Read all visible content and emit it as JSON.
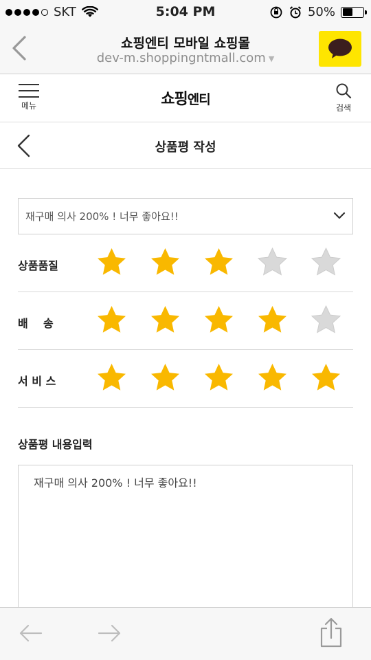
{
  "status_bar": {
    "carrier": "SKT",
    "time": "5:04 PM",
    "battery": "50%",
    "signal_bars_filled": 4,
    "signal_bars_total": 5,
    "battery_level": 0.5
  },
  "browser": {
    "title": "쇼핑엔티 모바일 쇼핑몰",
    "url": "dev-m.shoppingntmall.com",
    "kakao_button_color": "#fee500"
  },
  "site_header": {
    "menu_label": "메뉴",
    "logo_bold": "쇼핑",
    "logo_rest": "엔티",
    "search_label": "검색"
  },
  "page": {
    "title": "상품평 작성"
  },
  "review": {
    "selected_title": "재구매 의사 200% ! 너무 좋아요!!",
    "ratings": [
      {
        "label": "상품품질",
        "score": 3,
        "max": 5
      },
      {
        "label": "배    송",
        "score": 4,
        "max": 5
      },
      {
        "label": "서 비 스",
        "score": 5,
        "max": 5
      }
    ],
    "content_label": "상품평 내용입력",
    "content_text": "재구매 의사 200% ! 너무 좋아요!!"
  },
  "colors": {
    "star_filled": "#f9b800",
    "star_empty": "#d9d9d9",
    "accent": "#fee500"
  },
  "icons": {
    "browser_back": "chevron-left-icon",
    "kakao": "kakao-talk-icon",
    "menu": "hamburger-icon",
    "search": "search-icon",
    "page_back": "chevron-left-icon",
    "select": "chevron-down-icon",
    "star": "star-icon",
    "nav_back": "arrow-left-icon",
    "nav_forward": "arrow-right-icon",
    "share": "share-icon"
  }
}
